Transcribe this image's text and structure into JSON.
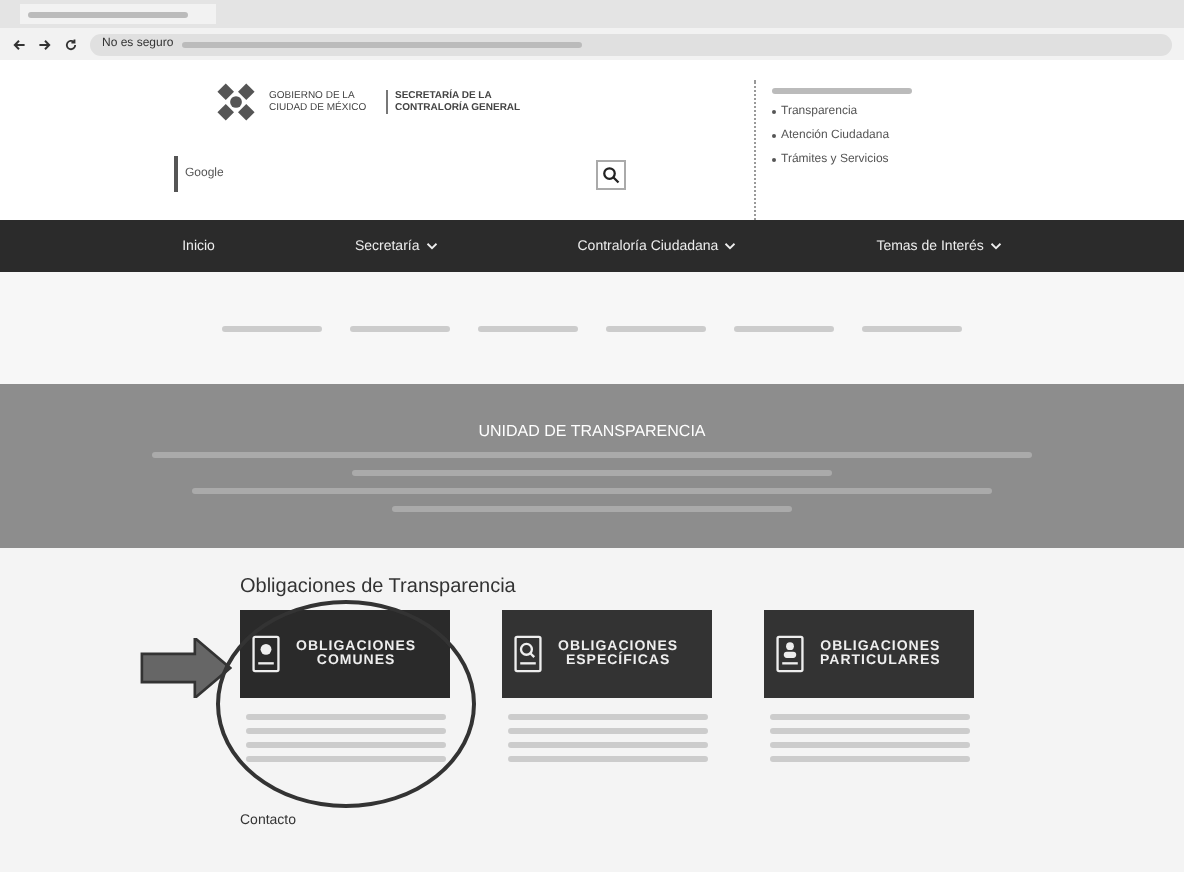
{
  "browser": {
    "address_warning": "No es seguro"
  },
  "header": {
    "logo_left": "GOBIERNO DE LA CIUDAD DE MÉXICO",
    "logo_right": "SECRETARÍA DE LA CONTRALORÍA GENERAL",
    "search": {
      "placeholder": "Google"
    },
    "links": [
      "Transparencia",
      "Atención Ciudadana",
      "Trámites y Servicios"
    ]
  },
  "nav": [
    {
      "label": "Inicio",
      "dropdown": false
    },
    {
      "label": "Secretaría",
      "dropdown": true
    },
    {
      "label": "Contraloría Ciudadana",
      "dropdown": true
    },
    {
      "label": "Temas de Interés",
      "dropdown": true
    }
  ],
  "banner": {
    "title": "UNIDAD DE TRANSPARENCIA"
  },
  "section_title": "Obligaciones de Transparencia",
  "cards": [
    {
      "title_line_1": "OBLIGACIONES",
      "title_line_2": "COMUNES",
      "highlighted": true
    },
    {
      "title_line_1": "OBLIGACIONES",
      "title_line_2": "ESPECÍFICAS",
      "highlighted": false
    },
    {
      "title_line_1": "OBLIGACIONES",
      "title_line_2": "PARTICULARES",
      "highlighted": false
    }
  ],
  "footer_heading": "Contacto"
}
